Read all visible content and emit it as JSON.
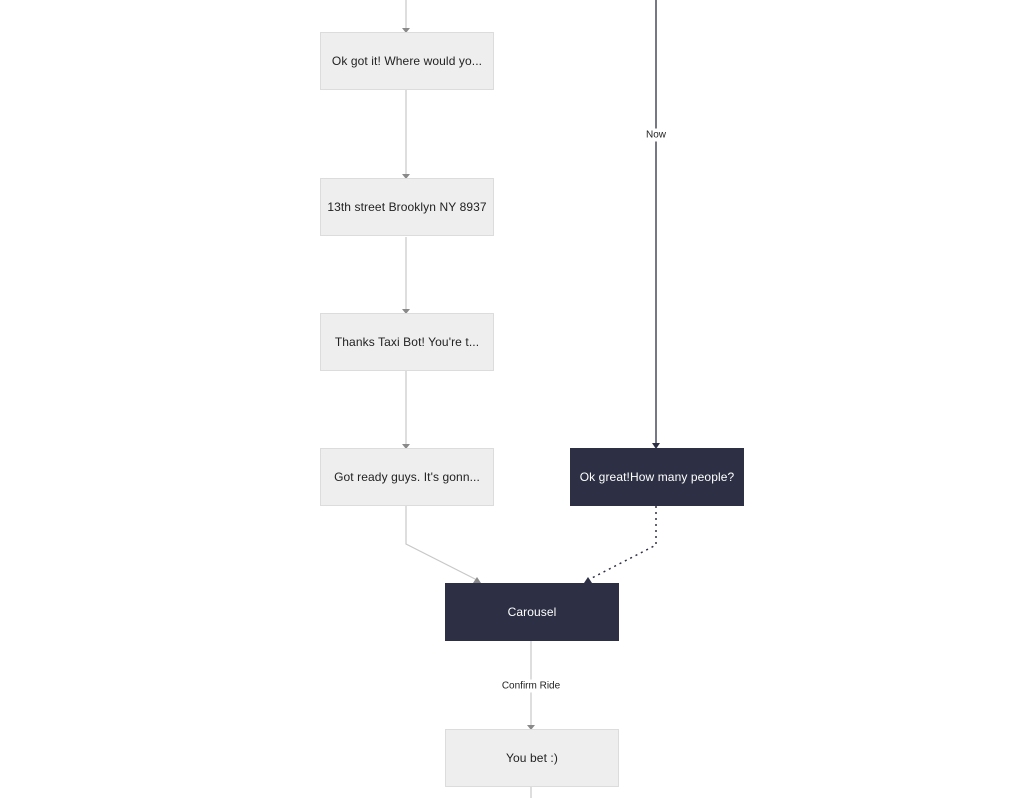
{
  "diagram": {
    "colors": {
      "light_node_bg": "#eeeeee",
      "dark_node_bg": "#2d3044",
      "light_edge": "#c8c8c8",
      "dark_edge": "#2d3044"
    },
    "nodes": [
      {
        "id": "n1",
        "label": "Ok got it! Where would yo...",
        "style": "light"
      },
      {
        "id": "n2",
        "label": "13th street Brooklyn NY 8937",
        "style": "light"
      },
      {
        "id": "n3",
        "label": "Thanks Taxi Bot! You're t...",
        "style": "light"
      },
      {
        "id": "n4",
        "label": "Got ready guys. It's gonn...",
        "style": "light"
      },
      {
        "id": "n5",
        "label": "Ok great!How many people?",
        "style": "dark"
      },
      {
        "id": "n6",
        "label": "Carousel",
        "style": "dark"
      },
      {
        "id": "n7",
        "label": "You bet :)",
        "style": "light"
      }
    ],
    "edges": [
      {
        "from": "above",
        "to": "n1",
        "style": "light",
        "label": ""
      },
      {
        "from": "n1",
        "to": "n2",
        "style": "light",
        "label": ""
      },
      {
        "from": "n2",
        "to": "n3",
        "style": "light",
        "label": ""
      },
      {
        "from": "n3",
        "to": "n4",
        "style": "light",
        "label": ""
      },
      {
        "from": "above",
        "to": "n5",
        "style": "dark",
        "label": "Now"
      },
      {
        "from": "n4",
        "to": "n6",
        "style": "light",
        "label": ""
      },
      {
        "from": "n5",
        "to": "n6",
        "style": "dark-dotted",
        "label": ""
      },
      {
        "from": "n6",
        "to": "n7",
        "style": "light",
        "label": "Confirm Ride"
      },
      {
        "from": "n7",
        "to": "below",
        "style": "light",
        "label": ""
      }
    ],
    "edge_labels": {
      "now": "Now",
      "confirm_ride": "Confirm Ride"
    }
  }
}
